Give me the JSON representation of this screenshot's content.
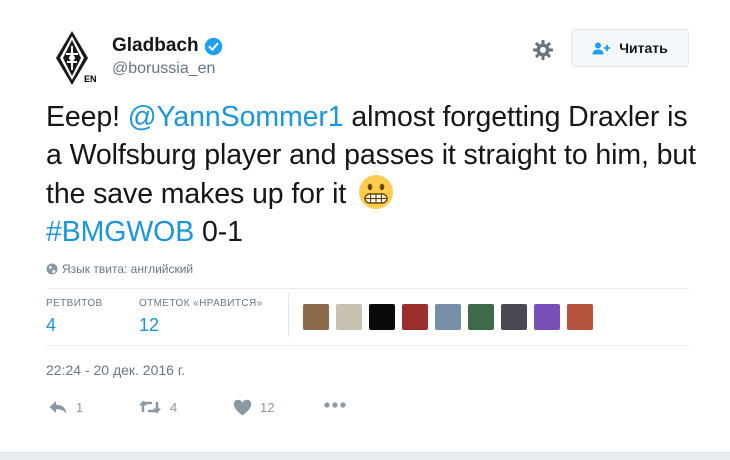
{
  "user": {
    "display_name": "Gladbach",
    "handle": "@borussia_en",
    "avatar_badge": "EN",
    "verified": true
  },
  "follow_button": {
    "label": "Читать"
  },
  "tweet": {
    "text_1": "Eeep! ",
    "mention": "@YannSommer1",
    "text_2": " almost forgetting Draxler is a Wolfsburg player and passes it straight to him, but the save makes up for it ",
    "hashtag": "#BMGWOB",
    "text_3": " 0-1",
    "emoji": "grimacing-face"
  },
  "language_note": "Язык твита: английский",
  "stats": {
    "retweets_label": "РЕТВИТОВ",
    "retweets_value": "4",
    "likes_label": "ОТМЕТОК «НРАВИТСЯ»",
    "likes_value": "12"
  },
  "likers": [
    {
      "name": "liker-1",
      "color": "#8a6a4a"
    },
    {
      "name": "liker-2",
      "color": "#c9c2b0"
    },
    {
      "name": "liker-3",
      "color": "#0a0a0a"
    },
    {
      "name": "liker-4",
      "color": "#9b2d2d"
    },
    {
      "name": "liker-5",
      "color": "#7a8fa8"
    },
    {
      "name": "liker-6",
      "color": "#3d6b4a"
    },
    {
      "name": "liker-7",
      "color": "#4a4a52"
    },
    {
      "name": "liker-8",
      "color": "#7b4fb8"
    },
    {
      "name": "liker-9",
      "color": "#b5533a"
    }
  ],
  "timestamp": "22:24 - 20 дек. 2016 г.",
  "actions": {
    "reply_count": "1",
    "retweet_count": "4",
    "like_count": "12"
  },
  "colors": {
    "link": "#1b95e0",
    "muted": "#657786",
    "icon": "#8899a6"
  }
}
